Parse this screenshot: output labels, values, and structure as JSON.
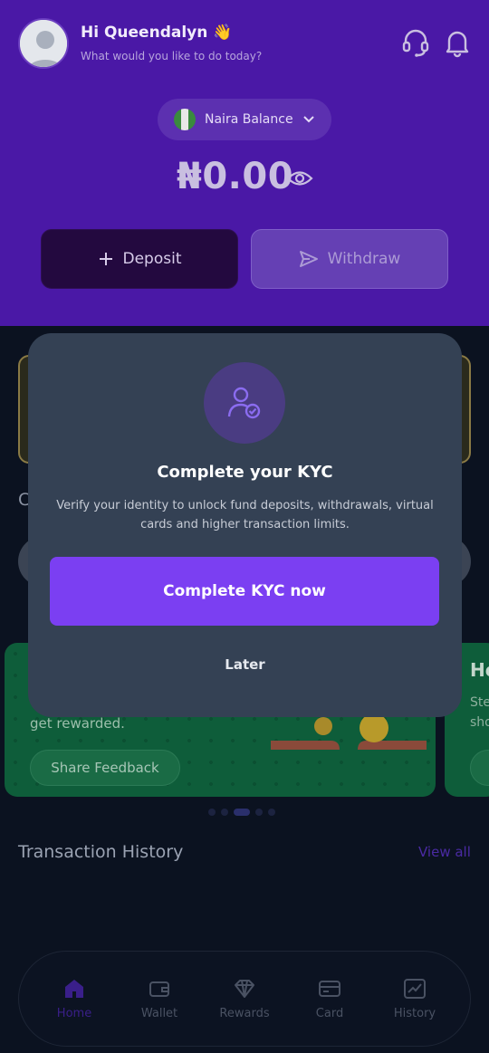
{
  "header": {
    "greeting": "Hi Queendalyn 👋",
    "subtitle": "What would you like to do today?",
    "balance_selector": "Naira Balance",
    "balance_amount": "₦0.00",
    "deposit_label": "Deposit",
    "withdraw_label": "Withdraw"
  },
  "background": {
    "promo_text": "get rewarded.",
    "feedback_button": "Share Feedback",
    "promo2_title": "Ho",
    "promo2_line1": "Ste",
    "promo2_line2": "sho",
    "section_partial": "C"
  },
  "transactions": {
    "title": "Transaction History",
    "view_all": "View all"
  },
  "modal": {
    "title": "Complete your KYC",
    "description": "Verify your identity to unlock fund deposits, withdrawals, virtual cards and higher transaction limits.",
    "cta_label": "Complete KYC now",
    "later_label": "Later"
  },
  "nav": {
    "items": [
      {
        "label": "Home",
        "icon": "home-icon"
      },
      {
        "label": "Wallet",
        "icon": "wallet-icon"
      },
      {
        "label": "Rewards",
        "icon": "diamond-icon"
      },
      {
        "label": "Card",
        "icon": "card-icon"
      },
      {
        "label": "History",
        "icon": "chart-icon"
      }
    ],
    "active": "Home"
  },
  "colors": {
    "header_bg": "#4a18a6",
    "accent": "#7b3ff2",
    "modal_bg": "#344154"
  }
}
